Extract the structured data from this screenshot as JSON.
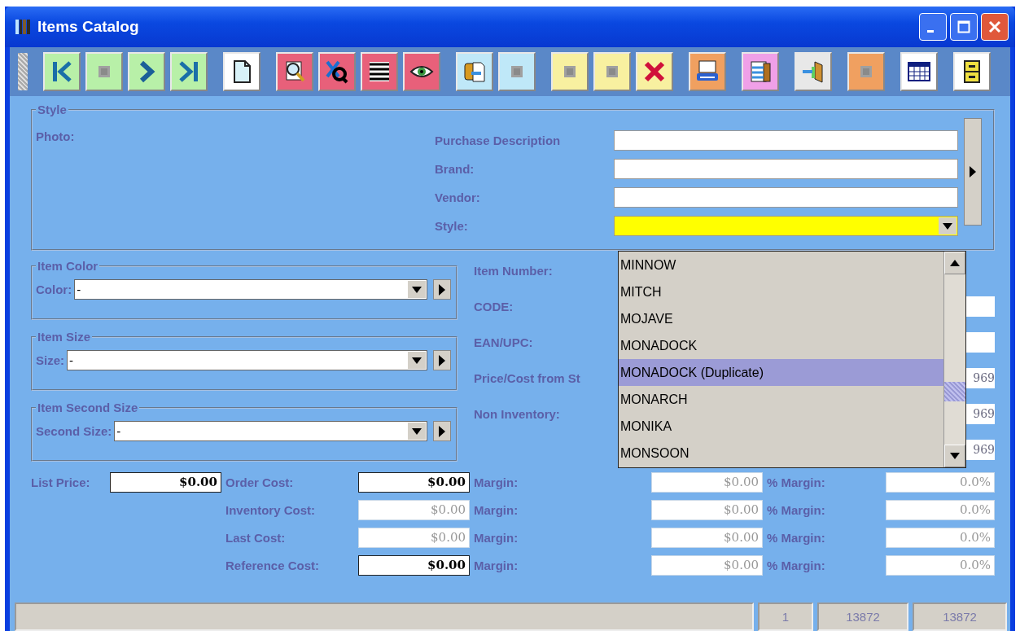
{
  "window": {
    "title": "Items Catalog"
  },
  "toolbar": {
    "groups": [
      [
        {
          "kind": "first",
          "color": "#b8f0a8",
          "disabled": false
        },
        {
          "kind": "prev",
          "color": "#b8f0a8",
          "disabled": true
        },
        {
          "kind": "next",
          "color": "#b8f0a8",
          "disabled": false
        },
        {
          "kind": "last",
          "color": "#b8f0a8",
          "disabled": false
        }
      ],
      [
        {
          "kind": "new",
          "color": "#ffffff",
          "disabled": false
        }
      ],
      [
        {
          "kind": "find",
          "color": "#e8607a",
          "disabled": false
        },
        {
          "kind": "clear-find",
          "color": "#e8607a",
          "disabled": false
        },
        {
          "kind": "list",
          "color": "#e8607a",
          "disabled": false
        },
        {
          "kind": "view",
          "color": "#e8607a",
          "disabled": false
        }
      ],
      [
        {
          "kind": "export",
          "color": "#bfe8f8",
          "disabled": false
        },
        {
          "kind": "copy",
          "color": "#bfe8f8",
          "disabled": true
        }
      ],
      [
        {
          "kind": "edit",
          "color": "#f8f0a0",
          "disabled": true
        },
        {
          "kind": "paste",
          "color": "#f8f0a0",
          "disabled": true
        },
        {
          "kind": "delete",
          "color": "#f8f0a0",
          "disabled": false
        }
      ],
      [
        {
          "kind": "print",
          "color": "#f0a060",
          "disabled": false
        }
      ],
      [
        {
          "kind": "import",
          "color": "#f0a0e8",
          "disabled": false
        }
      ],
      [
        {
          "kind": "exit",
          "color": "#e8e8e8",
          "disabled": false
        }
      ],
      [
        {
          "kind": "grid",
          "color": "#f0a060",
          "disabled": true
        }
      ],
      [
        {
          "kind": "table",
          "color": "#ffffff",
          "disabled": false
        }
      ],
      [
        {
          "kind": "cabinet",
          "color": "#ffffff",
          "disabled": false
        }
      ]
    ]
  },
  "style_group": {
    "legend": "Style",
    "photo_label": "Photo:",
    "fields": [
      {
        "label": "Purchase Description",
        "kind": "text",
        "focused": false
      },
      {
        "label": "Brand:",
        "kind": "text",
        "focused": false
      },
      {
        "label": "Vendor:",
        "kind": "text",
        "focused": false
      },
      {
        "label": "Style:",
        "kind": "combo",
        "focused": true
      }
    ]
  },
  "style_dropdown": {
    "items": [
      {
        "label": "MINNOW",
        "selected": false
      },
      {
        "label": "MITCH",
        "selected": false
      },
      {
        "label": "MOJAVE",
        "selected": false
      },
      {
        "label": "MONADOCK",
        "selected": false
      },
      {
        "label": "MONADOCK (Duplicate)",
        "selected": true
      },
      {
        "label": "MONARCH",
        "selected": false
      },
      {
        "label": "MONIKA",
        "selected": false
      },
      {
        "label": "MONSOON",
        "selected": false
      }
    ]
  },
  "option_groups": [
    {
      "legend": "Item Color",
      "label": "Color:",
      "value": "-"
    },
    {
      "legend": "Item Size",
      "label": "Size:",
      "value": "-"
    },
    {
      "legend": "Item Second Size",
      "label": "Second Size:",
      "value": "-"
    }
  ],
  "item_fields": [
    {
      "label": "Item Number:",
      "kind": "none"
    },
    {
      "label": "CODE:",
      "kind": "text"
    },
    {
      "label": "EAN/UPC:",
      "kind": "text"
    },
    {
      "label": "Price/Cost from St",
      "kind": "text",
      "value": "969"
    },
    {
      "label": "Non Inventory:",
      "kind": "text",
      "value": "969"
    },
    {
      "kind": "text",
      "value": "969"
    }
  ],
  "prices": {
    "list_price": {
      "label": "List Price:",
      "value": "$0.00"
    },
    "rows": [
      {
        "label": "Order Cost:",
        "cost": "$0.00",
        "disabled": false,
        "margin_label": "Margin:",
        "margin": "$0.00",
        "percent_label": "% Margin:",
        "percent": "0.0%"
      },
      {
        "label": "Inventory Cost:",
        "cost": "$0.00",
        "disabled": true,
        "margin_label": "Margin:",
        "margin": "$0.00",
        "percent_label": "% Margin:",
        "percent": "0.0%"
      },
      {
        "label": "Last Cost:",
        "cost": "$0.00",
        "disabled": true,
        "margin_label": "Margin:",
        "margin": "$0.00",
        "percent_label": "% Margin:",
        "percent": "0.0%"
      },
      {
        "label": "Reference Cost:",
        "cost": "$0.00",
        "disabled": false,
        "margin_label": "Margin:",
        "margin": "$0.00",
        "percent_label": "% Margin:",
        "percent": "0.0%"
      }
    ]
  },
  "status_bar": {
    "cells": [
      "1",
      "13872",
      "13872"
    ]
  }
}
